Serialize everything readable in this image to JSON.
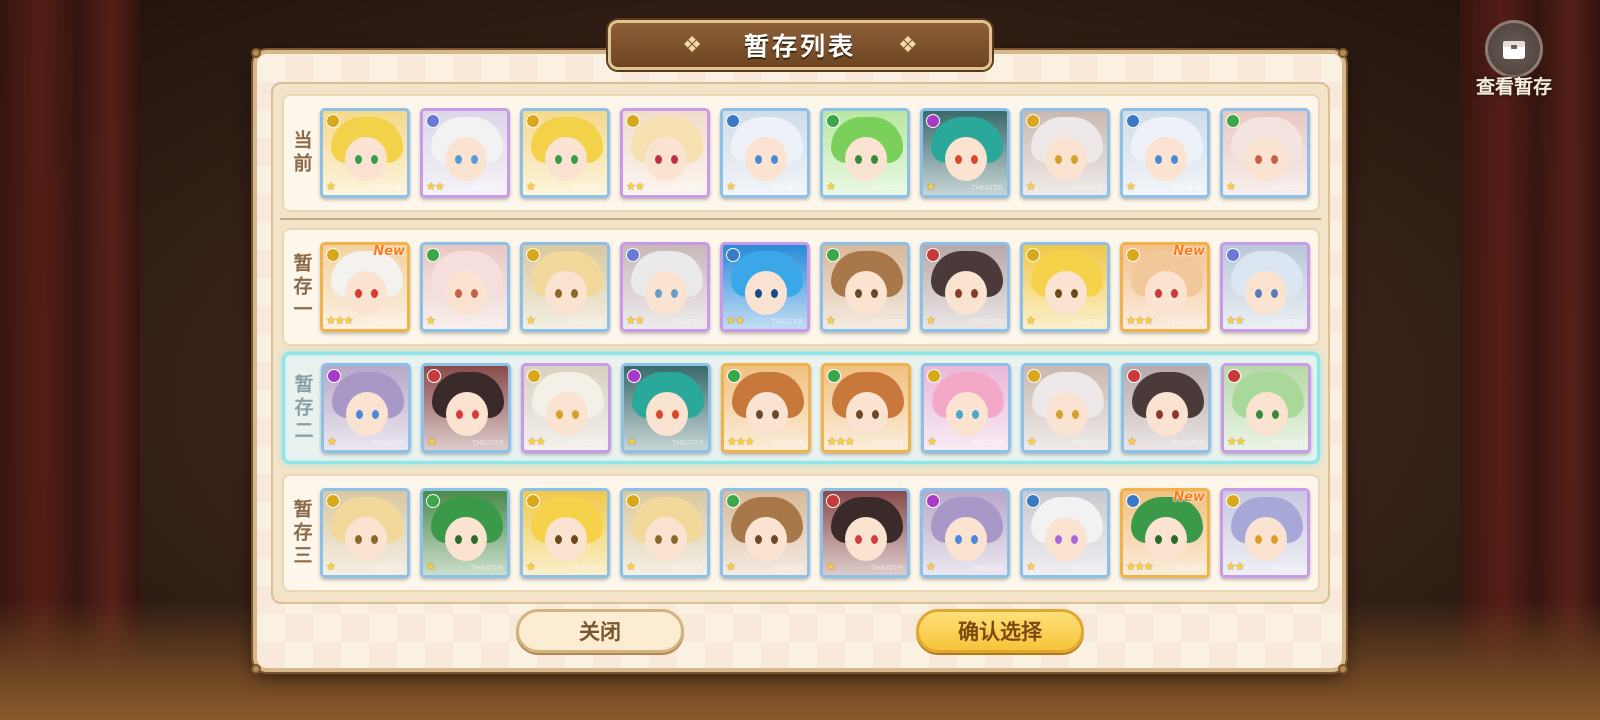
{
  "title": "暂存列表",
  "view_saved_label": "查看暂存",
  "buttons": {
    "close": "关闭",
    "confirm": "确认选择"
  },
  "card_caption": "THEATER",
  "new_label": "New",
  "rows": [
    {
      "label": "当前",
      "selected": false,
      "cards": [
        {
          "hair": "#f3d24a",
          "bg": "#f5d98a",
          "eyes": "#3a9c4a",
          "elem": "#d8a81a",
          "rarity": 1,
          "stars": "★",
          "new": false
        },
        {
          "hair": "#f2f2f2",
          "bg": "#dcd6e8",
          "eyes": "#5a9ad8",
          "elem": "#6a78d8",
          "rarity": 2,
          "stars": "★★",
          "new": false
        },
        {
          "hair": "#f3d24a",
          "bg": "#f5d98a",
          "eyes": "#3a9c4a",
          "elem": "#d8a81a",
          "rarity": 1,
          "stars": "★",
          "new": false
        },
        {
          "hair": "#f6e0b0",
          "bg": "#f1dcc8",
          "eyes": "#c0304a",
          "elem": "#d8a81a",
          "rarity": 2,
          "stars": "★★",
          "new": false
        },
        {
          "hair": "#eef2f8",
          "bg": "#cfdce8",
          "eyes": "#4a8ad8",
          "elem": "#3a78c8",
          "rarity": 1,
          "stars": "★",
          "new": false
        },
        {
          "hair": "#7ad05a",
          "bg": "#b8e8a0",
          "eyes": "#3a8a3a",
          "elem": "#3aa84a",
          "rarity": 1,
          "stars": "★",
          "new": false
        },
        {
          "hair": "#2aa89a",
          "bg": "#3a6a6a",
          "eyes": "#d84a2a",
          "elem": "#a83ac8",
          "rarity": 1,
          "stars": "★",
          "new": false
        },
        {
          "hair": "#efe8e8",
          "bg": "#c8b8b0",
          "eyes": "#d8a02a",
          "elem": "#d8a81a",
          "rarity": 1,
          "stars": "★",
          "new": false
        },
        {
          "hair": "#eef2f8",
          "bg": "#cfdce8",
          "eyes": "#4a8ad8",
          "elem": "#3a78c8",
          "rarity": 1,
          "stars": "★",
          "new": false
        },
        {
          "hair": "#f4e4e0",
          "bg": "#e8c8c0",
          "eyes": "#c8604a",
          "elem": "#3aa84a",
          "rarity": 1,
          "stars": "★",
          "new": false
        }
      ]
    },
    {
      "label": "暂存一",
      "selected": false,
      "cards": [
        {
          "hair": "#f4f2ee",
          "bg": "#f3d0a0",
          "eyes": "#d83a2a",
          "elem": "#d8a81a",
          "rarity": 3,
          "stars": "★★★",
          "new": true
        },
        {
          "hair": "#f6dede",
          "bg": "#e8c8c0",
          "eyes": "#c8604a",
          "elem": "#3aa84a",
          "rarity": 1,
          "stars": "★",
          "new": false
        },
        {
          "hair": "#f2d89a",
          "bg": "#d8c8a0",
          "eyes": "#8a6a2a",
          "elem": "#d8a81a",
          "rarity": 1,
          "stars": "★",
          "new": false
        },
        {
          "hair": "#eaeaea",
          "bg": "#c8b8b8",
          "eyes": "#6aa0c8",
          "elem": "#6a78d8",
          "rarity": 2,
          "stars": "★★",
          "new": false
        },
        {
          "hair": "#3aa8e8",
          "bg": "#2a8ad8",
          "eyes": "#1a4a8a",
          "elem": "#3a78c8",
          "rarity": 2,
          "stars": "★★",
          "new": false
        },
        {
          "hair": "#a8784a",
          "bg": "#d8b898",
          "eyes": "#6a4a2a",
          "elem": "#3aa84a",
          "rarity": 1,
          "stars": "★",
          "new": false
        },
        {
          "hair": "#4a3a3a",
          "bg": "#b8a8a8",
          "eyes": "#8a3a2a",
          "elem": "#c83a3a",
          "rarity": 1,
          "stars": "★",
          "new": false
        },
        {
          "hair": "#f6d24a",
          "bg": "#f0c84a",
          "eyes": "#6a4a1a",
          "elem": "#d8a81a",
          "rarity": 1,
          "stars": "★",
          "new": false
        },
        {
          "hair": "#f0c89a",
          "bg": "#f3c090",
          "eyes": "#c83a3a",
          "elem": "#d8a81a",
          "rarity": 3,
          "stars": "★★★",
          "new": true
        },
        {
          "hair": "#dce6f2",
          "bg": "#b8c8d8",
          "eyes": "#5a7ab8",
          "elem": "#6a78d8",
          "rarity": 2,
          "stars": "★★",
          "new": false
        }
      ]
    },
    {
      "label": "暂存二",
      "selected": true,
      "cards": [
        {
          "hair": "#a898c8",
          "bg": "#b8a8c8",
          "eyes": "#4a8ad8",
          "elem": "#a83ac8",
          "rarity": 1,
          "stars": "★",
          "new": false
        },
        {
          "hair": "#3a2a2a",
          "bg": "#8a4a4a",
          "eyes": "#d83a3a",
          "elem": "#c83a3a",
          "rarity": 1,
          "stars": "★",
          "new": false
        },
        {
          "hair": "#f4f0e8",
          "bg": "#d8d0c0",
          "eyes": "#d8a02a",
          "elem": "#d8a81a",
          "rarity": 2,
          "stars": "★★",
          "new": false
        },
        {
          "hair": "#2aa89a",
          "bg": "#3a6a6a",
          "eyes": "#d84a2a",
          "elem": "#a83ac8",
          "rarity": 1,
          "stars": "★",
          "new": false
        },
        {
          "hair": "#c8783a",
          "bg": "#f0c080",
          "eyes": "#6a4a2a",
          "elem": "#3aa84a",
          "rarity": 3,
          "stars": "★★★",
          "new": false
        },
        {
          "hair": "#c8783a",
          "bg": "#f0c080",
          "eyes": "#6a4a2a",
          "elem": "#3aa84a",
          "rarity": 3,
          "stars": "★★★",
          "new": false
        },
        {
          "hair": "#f4a8c8",
          "bg": "#e8b8d8",
          "eyes": "#4aa8c8",
          "elem": "#d8a81a",
          "rarity": 1,
          "stars": "★",
          "new": false
        },
        {
          "hair": "#efe8e8",
          "bg": "#c8b8b0",
          "eyes": "#d8a02a",
          "elem": "#d8a81a",
          "rarity": 1,
          "stars": "★",
          "new": false
        },
        {
          "hair": "#4a3a3a",
          "bg": "#b8a8a8",
          "eyes": "#8a3a2a",
          "elem": "#c83a3a",
          "rarity": 1,
          "stars": "★",
          "new": false
        },
        {
          "hair": "#a8d89a",
          "bg": "#b8d8a8",
          "eyes": "#3a8a3a",
          "elem": "#c83a3a",
          "rarity": 2,
          "stars": "★★",
          "new": false
        }
      ]
    },
    {
      "label": "暂存三",
      "selected": false,
      "cards": [
        {
          "hair": "#f2d89a",
          "bg": "#d8c8a0",
          "eyes": "#8a6a2a",
          "elem": "#d8a81a",
          "rarity": 1,
          "stars": "★",
          "new": false
        },
        {
          "hair": "#3a9a4a",
          "bg": "#4a8a4a",
          "eyes": "#2a6a2a",
          "elem": "#3aa84a",
          "rarity": 1,
          "stars": "★",
          "new": false
        },
        {
          "hair": "#f6d24a",
          "bg": "#f0c84a",
          "eyes": "#6a4a1a",
          "elem": "#d8a81a",
          "rarity": 1,
          "stars": "★",
          "new": false
        },
        {
          "hair": "#f2d89a",
          "bg": "#d8c8a0",
          "eyes": "#8a6a2a",
          "elem": "#d8a81a",
          "rarity": 1,
          "stars": "★",
          "new": false
        },
        {
          "hair": "#a8784a",
          "bg": "#d8b898",
          "eyes": "#6a4a2a",
          "elem": "#3aa84a",
          "rarity": 1,
          "stars": "★",
          "new": false
        },
        {
          "hair": "#3a2a2a",
          "bg": "#8a4a4a",
          "eyes": "#d83a3a",
          "elem": "#c83a3a",
          "rarity": 1,
          "stars": "★",
          "new": false
        },
        {
          "hair": "#a898c8",
          "bg": "#b8a8c8",
          "eyes": "#4a8ad8",
          "elem": "#a83ac8",
          "rarity": 1,
          "stars": "★",
          "new": false
        },
        {
          "hair": "#f2f2f2",
          "bg": "#c8c8d0",
          "eyes": "#a86ad8",
          "elem": "#3a78c8",
          "rarity": 1,
          "stars": "★",
          "new": false
        },
        {
          "hair": "#3a9a4a",
          "bg": "#f0c080",
          "eyes": "#2a6a2a",
          "elem": "#3a78c8",
          "rarity": 3,
          "stars": "★★★",
          "new": true
        },
        {
          "hair": "#a8a8d8",
          "bg": "#c8c8e0",
          "eyes": "#d8a02a",
          "elem": "#d8a81a",
          "rarity": 2,
          "stars": "★★",
          "new": false
        }
      ]
    }
  ]
}
